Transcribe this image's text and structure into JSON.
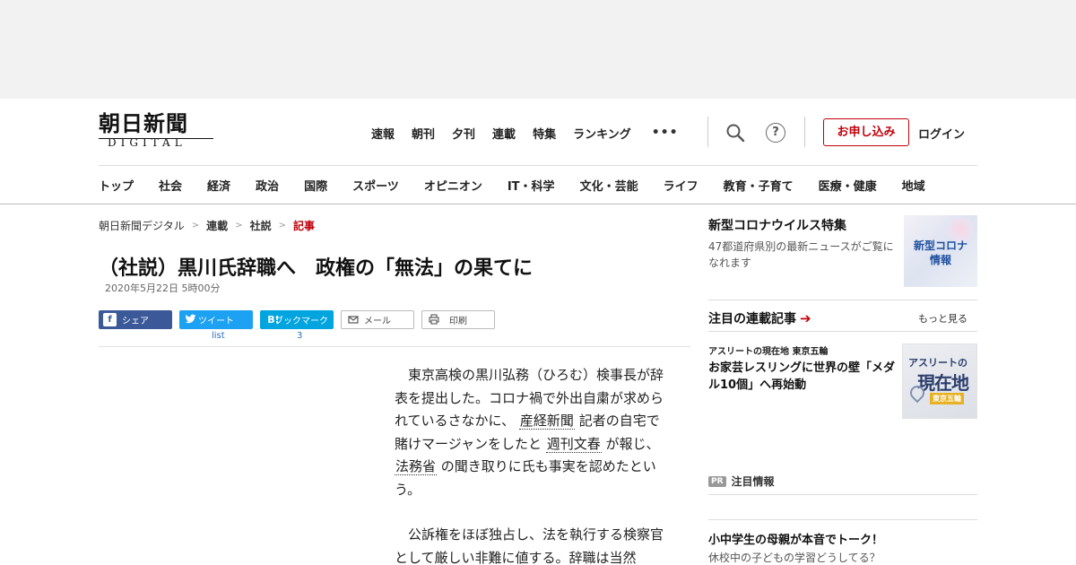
{
  "header": {
    "logo_main": "朝日新聞",
    "logo_sub": "DIGITAL",
    "top_nav": [
      "速報",
      "朝刊",
      "夕刊",
      "連載",
      "特集",
      "ランキング"
    ],
    "more_label": "•••",
    "help_label": "?",
    "subscribe_label": "お申し込み",
    "login_label": "ログイン",
    "main_nav": [
      "トップ",
      "社会",
      "経済",
      "政治",
      "国際",
      "スポーツ",
      "オピニオン",
      "IT・科学",
      "文化・芸能",
      "ライフ",
      "教育・子育て",
      "医療・健康",
      "地域"
    ]
  },
  "breadcrumb": [
    "朝日新聞デジタル",
    "連載",
    "社説",
    "記事"
  ],
  "article": {
    "title": "（社説）黒川氏辞職へ　政権の「無法」の果てに",
    "date": "2020年5月22日 5時00分",
    "share": {
      "facebook": "シェア",
      "twitter": "ツイート",
      "hatena": "ブックマーク",
      "mail": "メール",
      "print": "印刷",
      "twitter_count": "list",
      "hatena_count": "3"
    },
    "p1_a": "東京高検の黒川弘務（ひろむ）検事長が辞表を提出した。コロナ禍で外出自粛が求められているさなかに、",
    "p1_kw1": "産経新聞",
    "p1_b": "記者の自宅で賭けマージャンをしたと",
    "p1_kw2": "週刊文春",
    "p1_c": "が報じ、",
    "p1_kw3": "法務省",
    "p1_d": "の聞き取りに氏も事実を認めたという。",
    "p2": "公訴権をほぼ独占し、法を執行する検察官として厳しい非難に値する。辞職は当然"
  },
  "sidebar": {
    "covid_title": "新型コロナウイルス特集",
    "covid_desc": "47都道府県別の最新ニュースがご覧になれます",
    "covid_thumb_text": "新型コロナ\n情報",
    "series_title": "注目の連載記事",
    "more_label": "もっと見る",
    "series_item": {
      "category": "アスリートの現在地 東京五輪",
      "headline": "お家芸レスリングに世界の壁「メダル10個」へ再始動",
      "thumb_line1": "アスリートの",
      "thumb_line2": "現在地",
      "thumb_tag": "東京五輪"
    },
    "pr_badge": "PR",
    "pr_label": "注目情報",
    "pr_item": {
      "title": "小中学生の母親が本音でトーク！",
      "subtitle": "休校中の子どもの学習どうしてる？"
    }
  },
  "colors": {
    "accent_red": "#c0000a",
    "facebook": "#3b5998",
    "twitter": "#1da1f2",
    "hatena": "#00a4de"
  }
}
